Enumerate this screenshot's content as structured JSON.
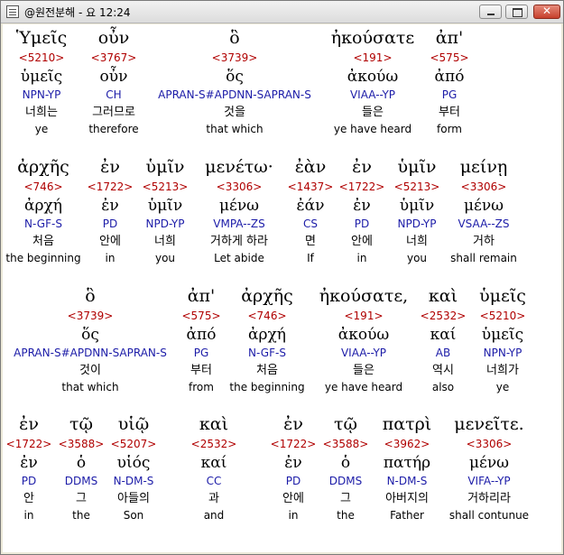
{
  "window": {
    "title": "@원전분해 - 요 12:24"
  },
  "rows": [
    {
      "units": [
        {
          "greek": "Ὑμεῖς",
          "num": "<5210>",
          "lemma": "ὑμεῖς",
          "parse": "NPN-YP",
          "korean": "너희는",
          "english": "ye"
        },
        {
          "greek": "οὖν",
          "num": "<3767>",
          "lemma": "οὖν",
          "parse": "CH",
          "korean": "그러므로",
          "english": "therefore"
        },
        {
          "greek": "ὃ",
          "num": "<3739>",
          "lemma": "ὅς",
          "parse": "APRAN-S#APDNN-SAPRAN-S",
          "korean": "것을",
          "english": "that which"
        },
        {
          "greek": "ἠκούσατε",
          "num": "<191>",
          "lemma": "ἀκούω",
          "parse": "VIAA--YP",
          "korean": "들은",
          "english": "ye have heard"
        },
        {
          "greek": "ἀπ'",
          "num": "<575>",
          "lemma": "ἀπό",
          "parse": "PG",
          "korean": "부터",
          "english": "form"
        }
      ]
    },
    {
      "units": [
        {
          "greek": "ἀρχῆς",
          "num": "<746>",
          "lemma": "ἀρχή",
          "parse": "N-GF-S",
          "korean": "처음",
          "english": "the beginning"
        },
        {
          "greek": "ἐν",
          "num": "<1722>",
          "lemma": "ἐν",
          "parse": "PD",
          "korean": "안에",
          "english": "in"
        },
        {
          "greek": "ὑμῖν",
          "num": "<5213>",
          "lemma": "ὑμῖν",
          "parse": "NPD-YP",
          "korean": "너희",
          "english": "you"
        },
        {
          "greek": "μενέτω·",
          "num": "<3306>",
          "lemma": "μένω",
          "parse": "VMPA--ZS",
          "korean": "거하게 하라",
          "english": "Let abide"
        },
        {
          "greek": "ἐὰν",
          "num": "<1437>",
          "lemma": "ἐάν",
          "parse": "CS",
          "korean": "면",
          "english": "If"
        },
        {
          "greek": "ἐν",
          "num": "<1722>",
          "lemma": "ἐν",
          "parse": "PD",
          "korean": "안에",
          "english": "in"
        },
        {
          "greek": "ὑμῖν",
          "num": "<5213>",
          "lemma": "ὑμῖν",
          "parse": "NPD-YP",
          "korean": "너희",
          "english": "you"
        },
        {
          "greek": "μείνῃ",
          "num": "<3306>",
          "lemma": "μένω",
          "parse": "VSAA--ZS",
          "korean": "거하",
          "english": "shall remain"
        }
      ]
    },
    {
      "units": [
        {
          "greek": "ὃ",
          "num": "<3739>",
          "lemma": "ὅς",
          "parse": "APRAN-S#APDNN-SAPRAN-S",
          "korean": "것이",
          "english": "that which"
        },
        {
          "greek": "ἀπ'",
          "num": "<575>",
          "lemma": "ἀπό",
          "parse": "PG",
          "korean": "부터",
          "english": "from"
        },
        {
          "greek": "ἀρχῆς",
          "num": "<746>",
          "lemma": "ἀρχή",
          "parse": "N-GF-S",
          "korean": "처음",
          "english": "the beginning"
        },
        {
          "greek": "ἠκούσατε,",
          "num": "<191>",
          "lemma": "ἀκούω",
          "parse": "VIAA--YP",
          "korean": "들은",
          "english": "ye have heard"
        },
        {
          "greek": "καὶ",
          "num": "<2532>",
          "lemma": "καί",
          "parse": "AB",
          "korean": "역시",
          "english": "also"
        },
        {
          "greek": "ὑμεῖς",
          "num": "<5210>",
          "lemma": "ὑμεῖς",
          "parse": "NPN-YP",
          "korean": "너희가",
          "english": "ye"
        }
      ]
    },
    {
      "units": [
        {
          "greek": "ἐν",
          "num": "<1722>",
          "lemma": "ἐν",
          "parse": "PD",
          "korean": "안",
          "english": "in"
        },
        {
          "greek": "τῷ",
          "num": "<3588>",
          "lemma": "ὁ",
          "parse": "DDMS",
          "korean": "그",
          "english": "the"
        },
        {
          "greek": "υἱῷ",
          "num": "<5207>",
          "lemma": "υἱός",
          "parse": "N-DM-S",
          "korean": "아들의",
          "english": "Son"
        },
        {
          "greek": "καὶ",
          "num": "<2532>",
          "lemma": "καί",
          "parse": "CC",
          "korean": "과",
          "english": "and"
        },
        {
          "greek": "ἐν",
          "num": "<1722>",
          "lemma": "ἐν",
          "parse": "PD",
          "korean": "안에",
          "english": "in"
        },
        {
          "greek": "τῷ",
          "num": "<3588>",
          "lemma": "ὁ",
          "parse": "DDMS",
          "korean": "그",
          "english": "the"
        },
        {
          "greek": "πατρὶ",
          "num": "<3962>",
          "lemma": "πατήρ",
          "parse": "N-DM-S",
          "korean": "아버지의",
          "english": "Father"
        },
        {
          "greek": "μενεῖτε.",
          "num": "<3306>",
          "lemma": "μένω",
          "parse": "VIFA--YP",
          "korean": "거하리라",
          "english": "shall contunue"
        }
      ]
    }
  ]
}
